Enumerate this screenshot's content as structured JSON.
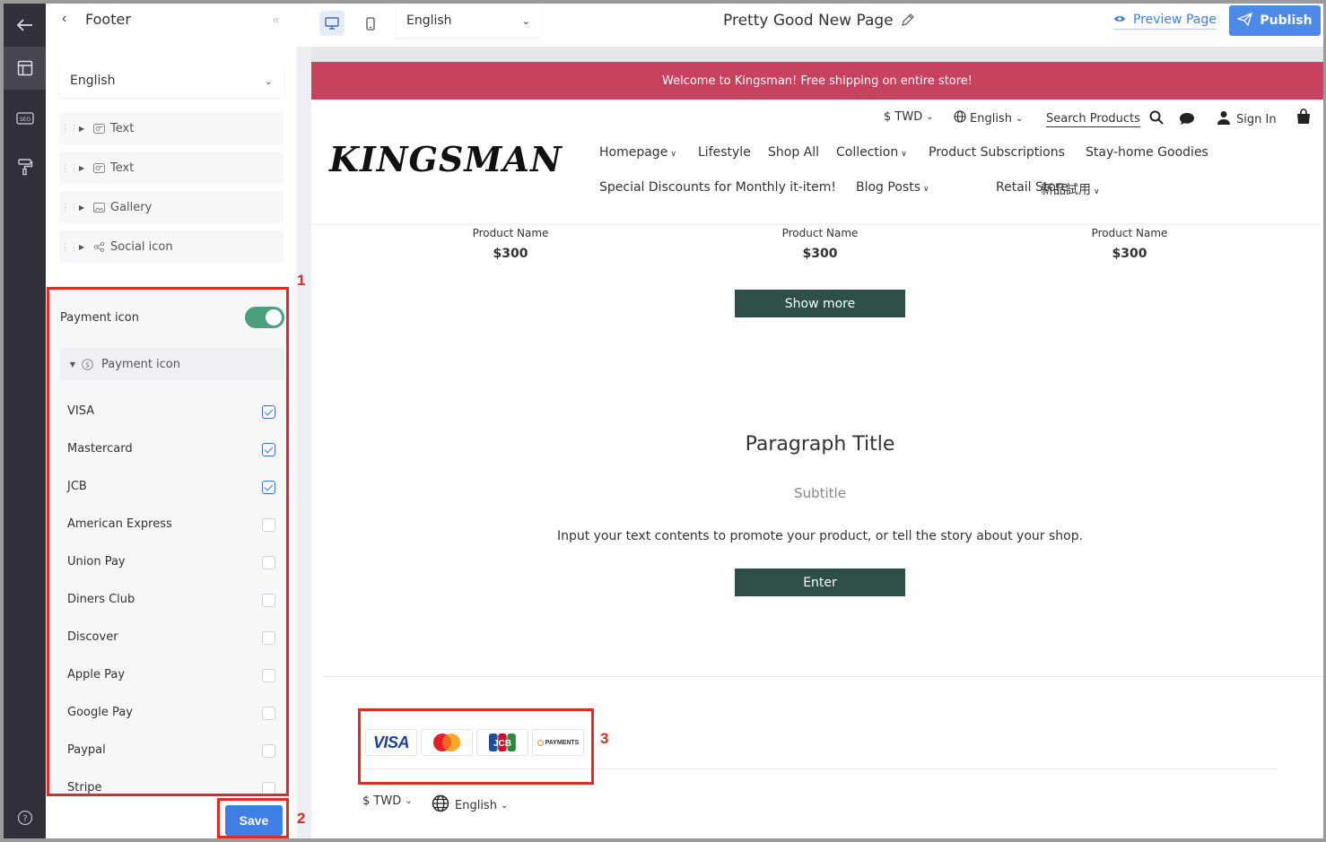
{
  "panel": {
    "title": "Footer",
    "language": "English",
    "tree": [
      {
        "label": "Text",
        "icon": "text-block-icon"
      },
      {
        "label": "Text",
        "icon": "text-block-icon"
      },
      {
        "label": "Gallery",
        "icon": "image-icon"
      },
      {
        "label": "Social icon",
        "icon": "share-icon"
      }
    ],
    "payment_toggle_label": "Payment icon",
    "payment_toggle_on": true,
    "payment_sub_label": "Payment icon",
    "payment_options": [
      {
        "label": "VISA",
        "checked": true
      },
      {
        "label": "Mastercard",
        "checked": true
      },
      {
        "label": "JCB",
        "checked": true
      },
      {
        "label": "American Express",
        "checked": false
      },
      {
        "label": "Union Pay",
        "checked": false
      },
      {
        "label": "Diners Club",
        "checked": false
      },
      {
        "label": "Discover",
        "checked": false
      },
      {
        "label": "Apple Pay",
        "checked": false
      },
      {
        "label": "Google Pay",
        "checked": false
      },
      {
        "label": "Paypal",
        "checked": false
      },
      {
        "label": "Stripe",
        "checked": false
      }
    ],
    "save_label": "Save"
  },
  "topbar": {
    "language": "English",
    "page_title": "Pretty Good New Page",
    "preview_label": "Preview Page",
    "publish_label": "Publish"
  },
  "site": {
    "announcement": "Welcome to Kingsman! Free shipping on entire store!",
    "currency": "$ TWD",
    "language": "English",
    "search_label": "Search Products",
    "sign_in": "Sign In",
    "logo": "KINGSMAN",
    "nav_row1": [
      "Homepage",
      "Lifestyle",
      "Shop All",
      "Collection",
      "Product Subscriptions",
      "Stay-home Goodies"
    ],
    "nav_row2": [
      "Special Discounts for Monthly it-item!",
      "Blog Posts",
      "Retail Store",
      "新品試用"
    ],
    "products": [
      {
        "name": "Product Name",
        "price": "$300"
      },
      {
        "name": "Product Name",
        "price": "$300"
      },
      {
        "name": "Product Name",
        "price": "$300"
      }
    ],
    "show_more": "Show more",
    "paragraph_title": "Paragraph Title",
    "subtitle": "Subtitle",
    "body": "Input your text contents to promote your product, or tell the story about your shop.",
    "enter": "Enter",
    "footer_payment_icons": [
      "VISA",
      "Mastercard",
      "JCB",
      "PAYMENTS"
    ],
    "footer_currency": "$ TWD",
    "footer_language": "English"
  },
  "annotations": [
    "1",
    "2",
    "3"
  ],
  "colors": {
    "announcement_bg": "#c7425f",
    "primary_blue": "#3f7fe4",
    "dark_button": "#2e4f48",
    "toggle_on": "#4c9f7d",
    "annotation_red": "#e02b22",
    "rail": "#2f3039"
  }
}
